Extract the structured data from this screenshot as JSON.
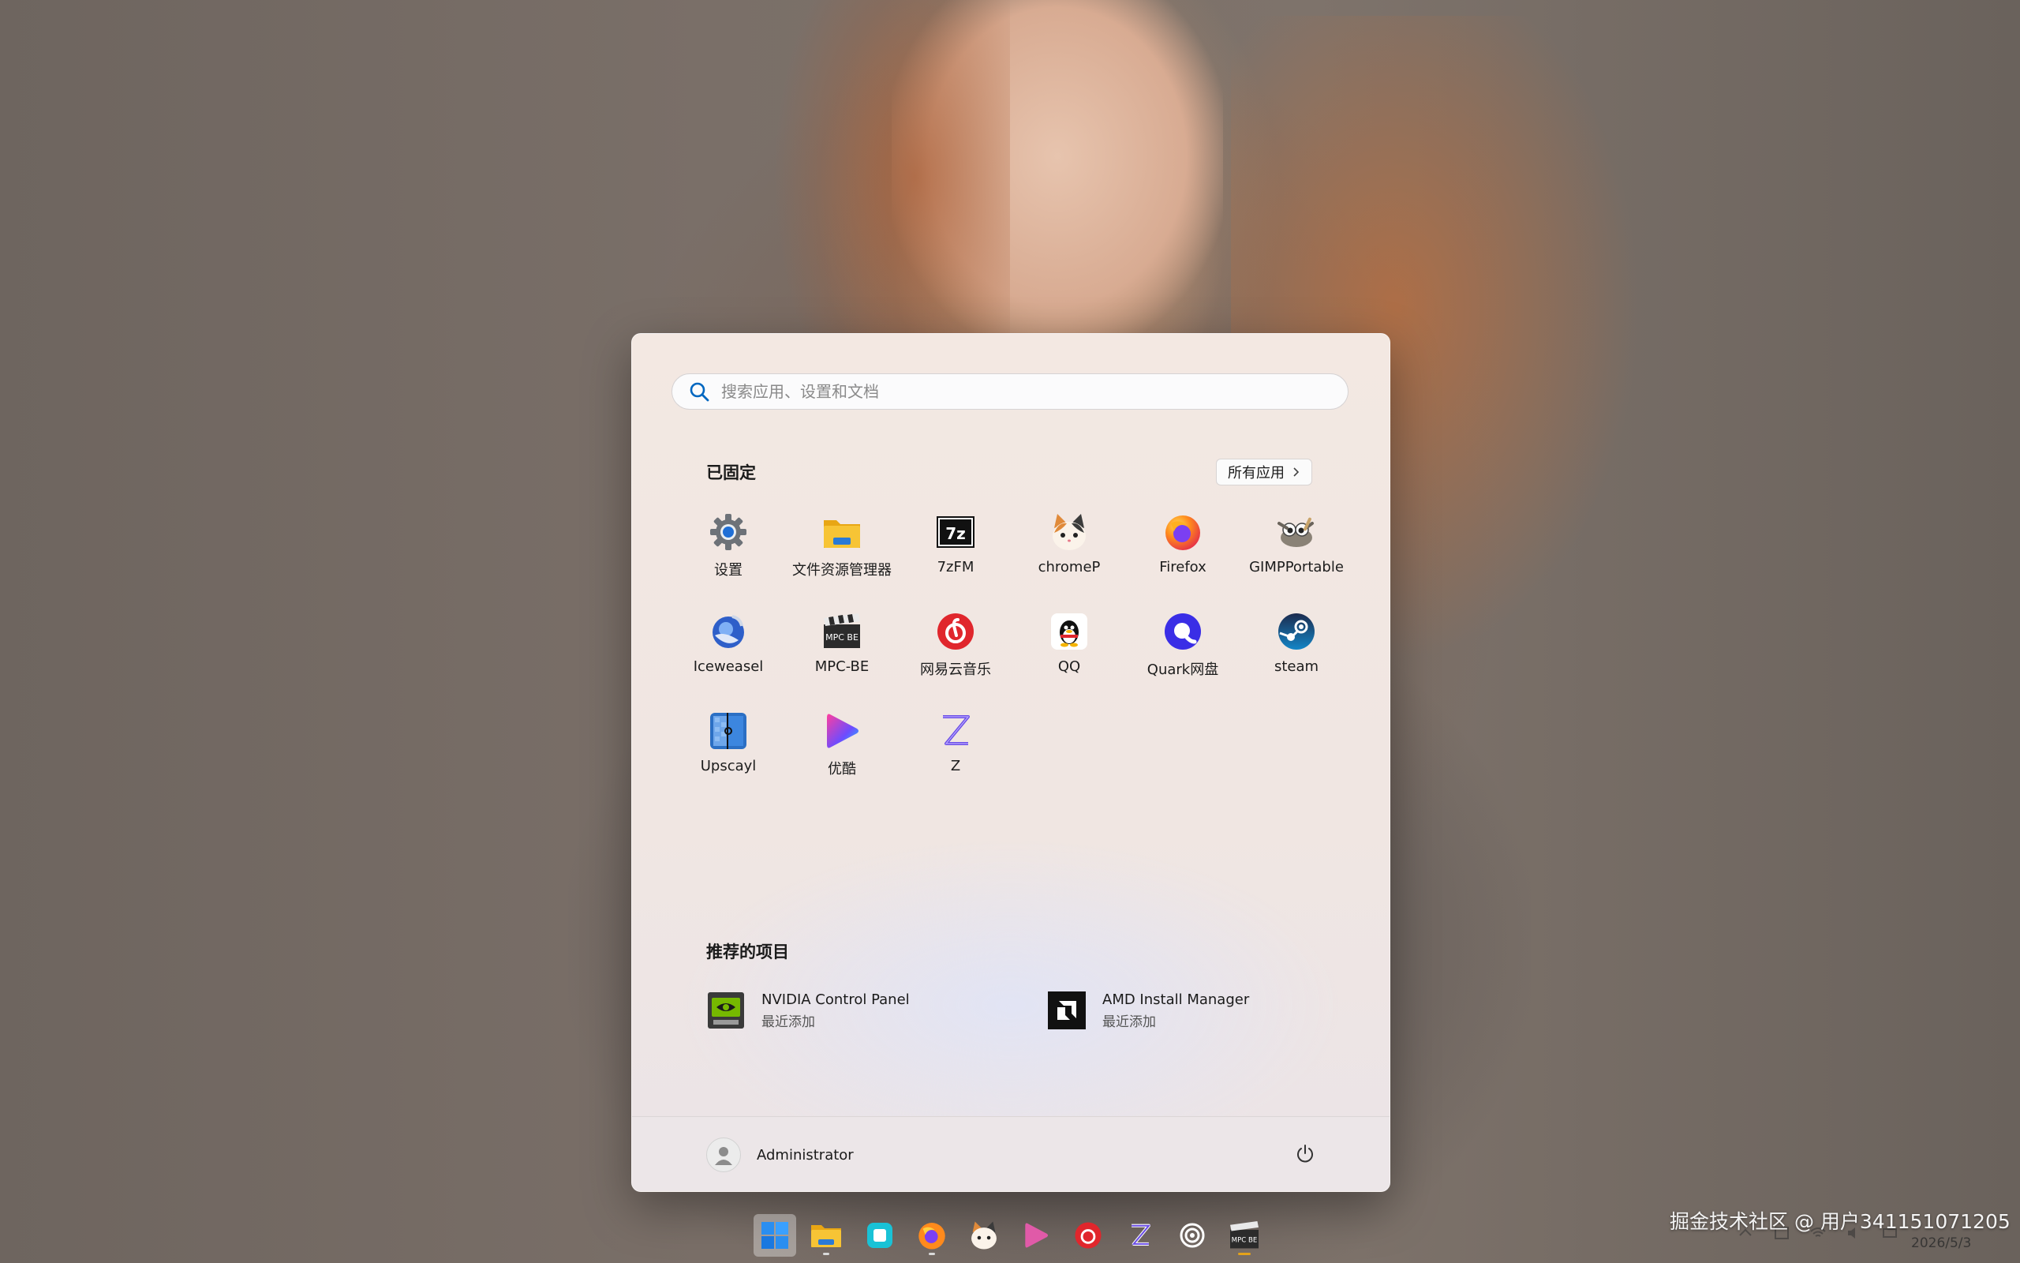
{
  "search": {
    "placeholder": "搜索应用、设置和文档"
  },
  "pinned": {
    "title": "已固定",
    "all_apps_label": "所有应用",
    "apps": [
      {
        "label": "设置",
        "icon": "settings-gear-icon"
      },
      {
        "label": "文件资源管理器",
        "icon": "folder-icon"
      },
      {
        "label": "7zFM",
        "icon": "7zip-icon"
      },
      {
        "label": "chromeP",
        "icon": "calico-cat-icon"
      },
      {
        "label": "Firefox",
        "icon": "firefox-icon"
      },
      {
        "label": "GIMPPortable",
        "icon": "gimp-icon"
      },
      {
        "label": "Iceweasel",
        "icon": "iceweasel-icon"
      },
      {
        "label": "MPC-BE",
        "icon": "mpc-be-clapper-icon"
      },
      {
        "label": "网易云音乐",
        "icon": "netease-music-icon"
      },
      {
        "label": "QQ",
        "icon": "qq-penguin-icon"
      },
      {
        "label": "Quark网盘",
        "icon": "quark-icon"
      },
      {
        "label": "steam",
        "icon": "steam-icon"
      },
      {
        "label": "Upscayl",
        "icon": "upscayl-icon"
      },
      {
        "label": "优酷",
        "icon": "youku-icon"
      },
      {
        "label": "Z",
        "icon": "z-letter-icon"
      }
    ]
  },
  "recommended": {
    "title": "推荐的项目",
    "items": [
      {
        "name": "NVIDIA Control Panel",
        "sub": "最近添加",
        "icon": "nvidia-icon"
      },
      {
        "name": "AMD Install Manager",
        "sub": "最近添加",
        "icon": "amd-icon"
      }
    ]
  },
  "footer": {
    "user_name": "Administrator"
  },
  "taskbar": {
    "icons": [
      "windows-start-icon",
      "file-explorer-icon",
      "app-square-icon",
      "firefox-icon",
      "calico-cat-icon",
      "youku-icon",
      "netease-music-icon",
      "z-letter-icon",
      "target-circle-icon",
      "mpc-be-icon"
    ]
  },
  "overlay": {
    "watermark": "掘金技术社区 @ 用户341151071205",
    "date": "2026/5/3"
  },
  "colors": {
    "accent": "#0067c0",
    "taskbar_active": "#e3a21a"
  }
}
